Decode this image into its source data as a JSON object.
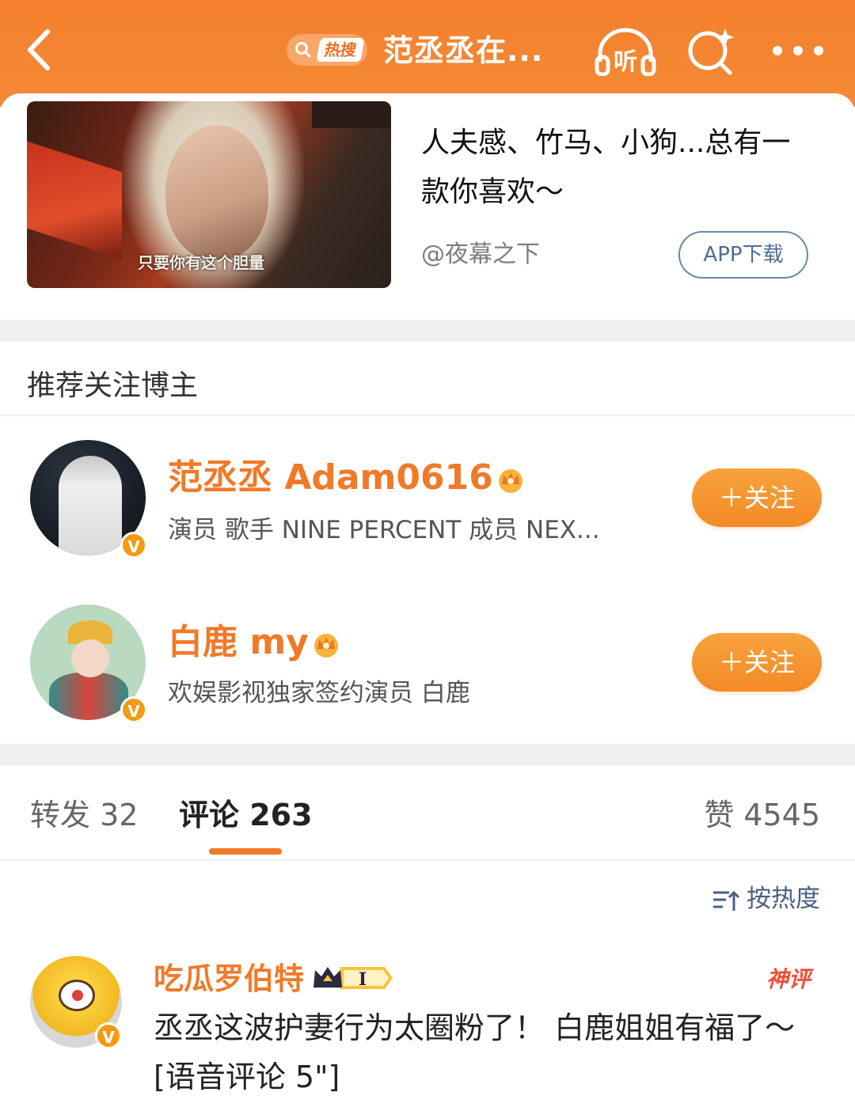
{
  "topbar": {
    "hot_label": "热搜",
    "title": "范丞丞在...",
    "listen_label": "听"
  },
  "ad": {
    "title": "人夫感、竹马、小狗...总有一款你喜欢～",
    "source": "@夜幕之下",
    "button_label": "APP下载",
    "image_caption": "只要你有这个胆量"
  },
  "recommend": {
    "section_title": "推荐关注博主",
    "users": [
      {
        "name": "范丞丞 Adam0616",
        "desc": "演员 歌手 NINE PERCENT 成员 NEX...",
        "follow_label": "＋关注",
        "verified_badge": "V"
      },
      {
        "name": "白鹿 my",
        "desc": "欢娱影视独家签约演员 白鹿",
        "follow_label": "＋关注",
        "verified_badge": "V"
      }
    ]
  },
  "tabs": {
    "repost": "转发 32",
    "comment": "评论 263",
    "like": "赞 4545"
  },
  "sort": {
    "label": "按热度"
  },
  "comments": [
    {
      "user": "吃瓜罗伯特",
      "level": "I",
      "tag": "神评",
      "text": "丞丞这波护妻行为太圈粉了！ 白鹿姐姐有福了～ [语音评论 5\"]",
      "verified_badge": "V"
    }
  ],
  "colors": {
    "brand": "#f07a28",
    "link_blue": "#4b6d95"
  }
}
